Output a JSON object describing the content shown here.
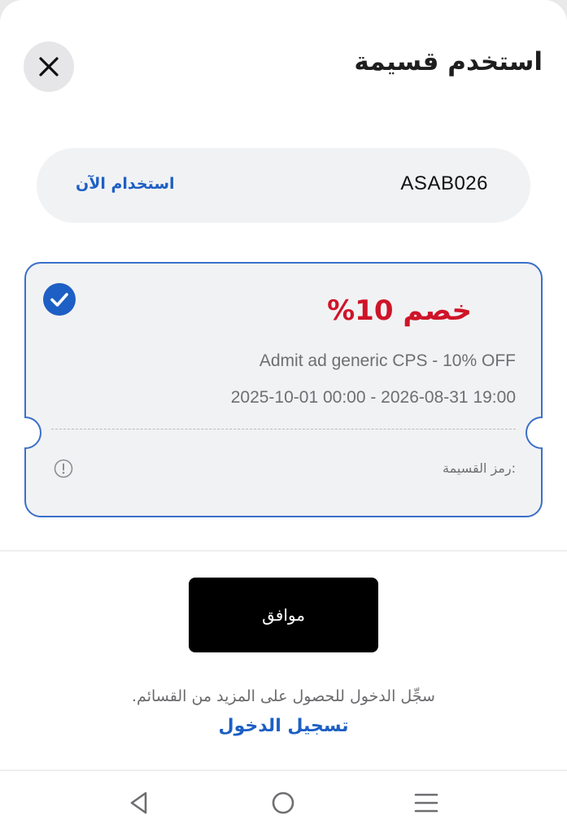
{
  "header": {
    "title": "استخدم قسيمة",
    "close_icon": "close-icon"
  },
  "code_bar": {
    "code": "ASAB026",
    "use_now_label": "استخدام الآن"
  },
  "coupon": {
    "selected": true,
    "discount": "خصم 10%",
    "description": "Admit ad generic CPS - 10% OFF",
    "validity": "2025-10-01 00:00 - 2026-08-31 19:00",
    "code_label": ":رمز القسيمة",
    "icons": [
      "check-circle-icon",
      "info-icon"
    ]
  },
  "actions": {
    "ok_label": "موافق",
    "login_note": "سجِّل الدخول للحصول على المزيد من القسائم.",
    "login_link": "تسجيل الدخول"
  },
  "nav_bar": {
    "icons": [
      "back-triangle-icon",
      "home-circle-icon",
      "menu-lines-icon"
    ]
  },
  "colors": {
    "accent_blue": "#1d5fc4",
    "discount_red": "#cf1428",
    "coupon_border": "#3a6fc8",
    "coupon_bg": "#f1f2f4"
  }
}
